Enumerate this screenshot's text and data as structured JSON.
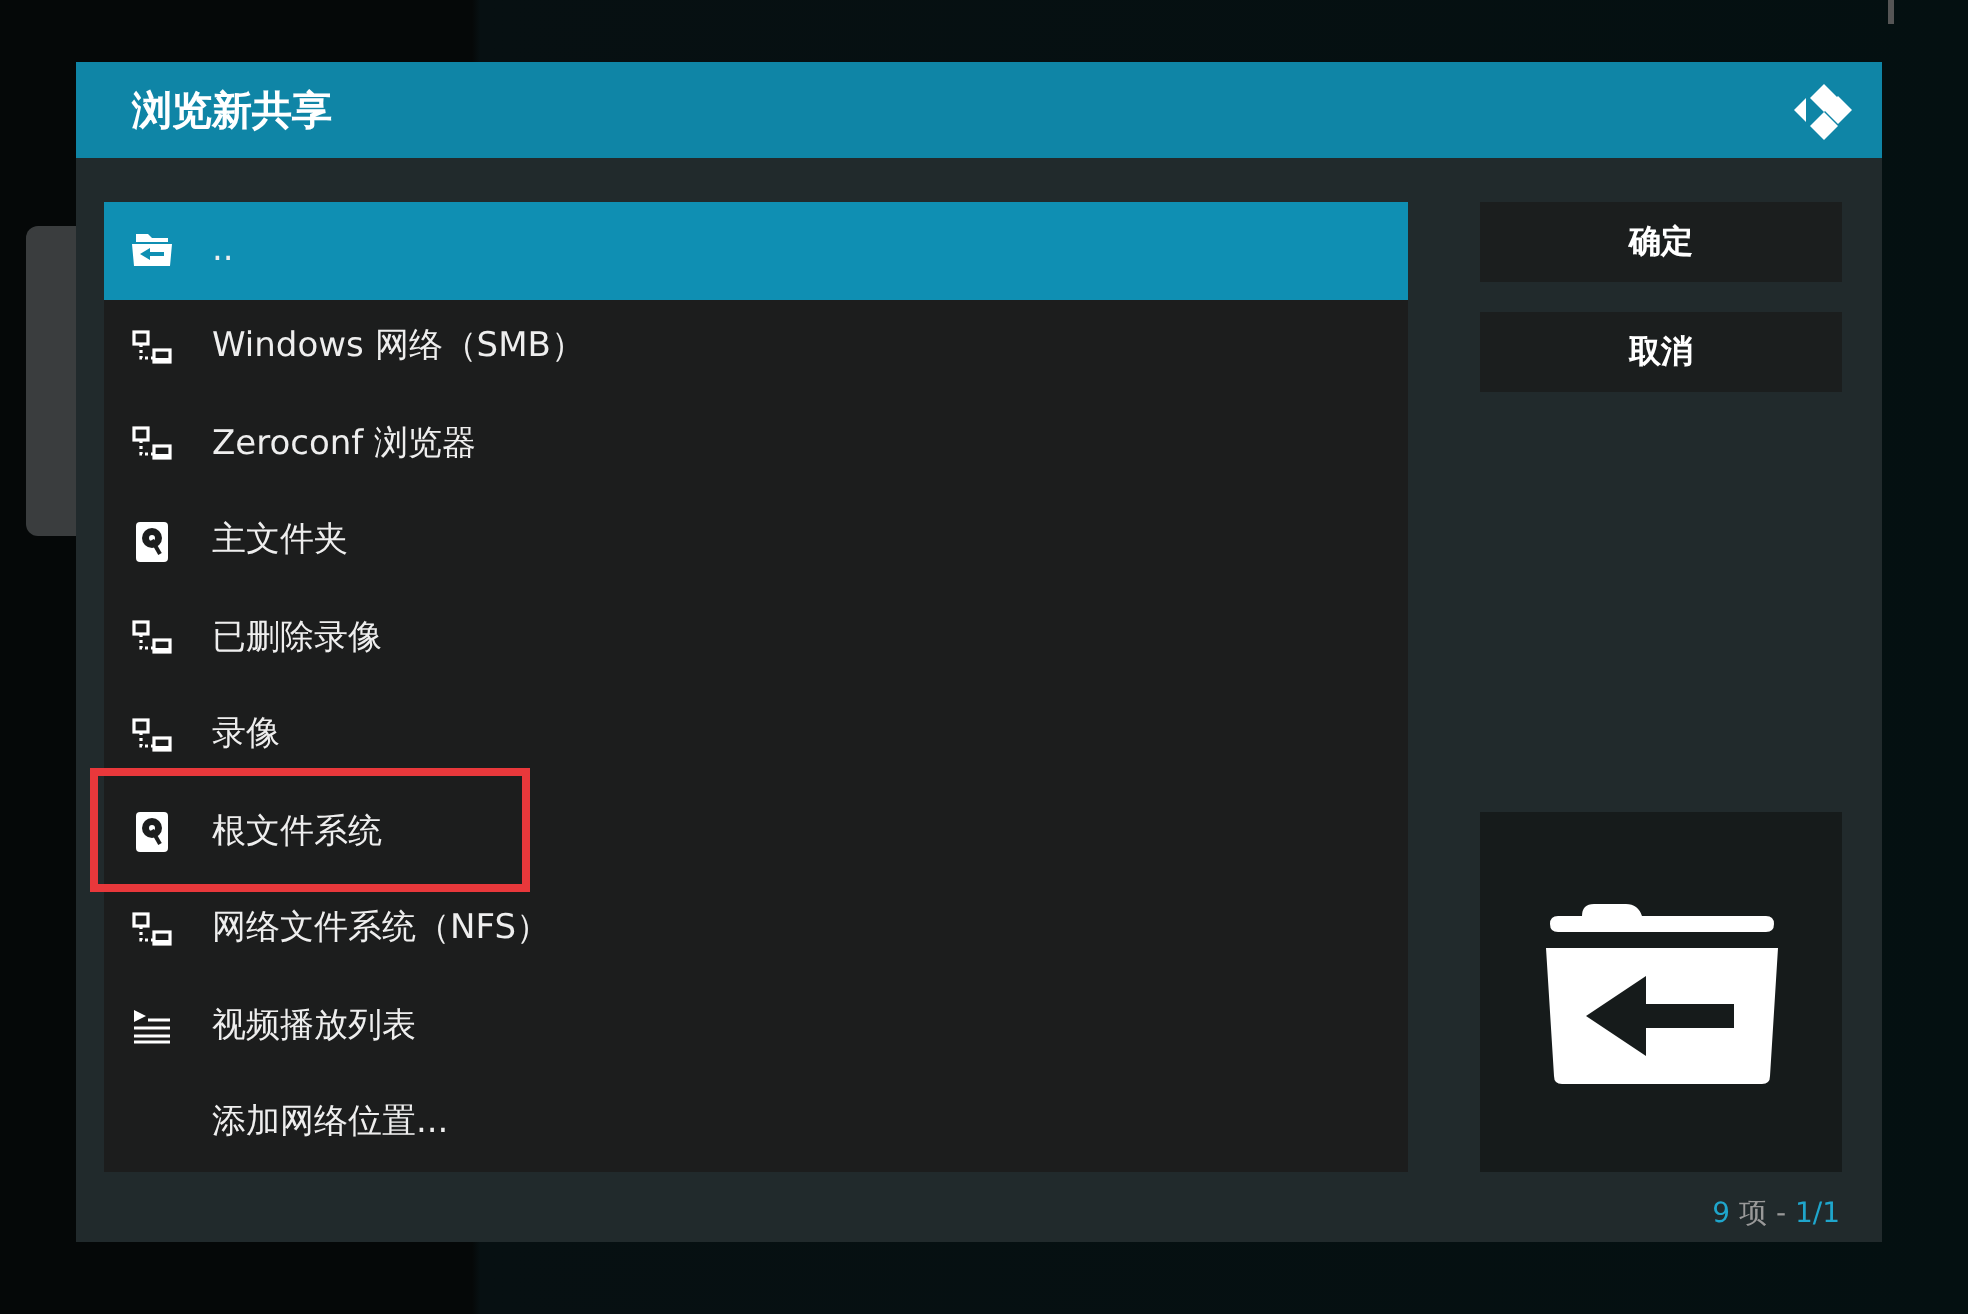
{
  "dialog": {
    "title": "浏览新共享"
  },
  "items": [
    {
      "label": "..",
      "kind": "parent",
      "selected": true,
      "highlighted": false
    },
    {
      "label": "Windows 网络（SMB）",
      "kind": "network",
      "selected": false,
      "highlighted": false
    },
    {
      "label": "Zeroconf 浏览器",
      "kind": "network",
      "selected": false,
      "highlighted": false
    },
    {
      "label": "主文件夹",
      "kind": "drive",
      "selected": false,
      "highlighted": false
    },
    {
      "label": "已删除录像",
      "kind": "network",
      "selected": false,
      "highlighted": false
    },
    {
      "label": "录像",
      "kind": "network",
      "selected": false,
      "highlighted": false
    },
    {
      "label": "根文件系统",
      "kind": "drive",
      "selected": false,
      "highlighted": true
    },
    {
      "label": "网络文件系统（NFS）",
      "kind": "network",
      "selected": false,
      "highlighted": false
    },
    {
      "label": "视频播放列表",
      "kind": "playlist",
      "selected": false,
      "highlighted": false
    },
    {
      "label": "添加网络位置...",
      "kind": "none",
      "selected": false,
      "highlighted": false
    }
  ],
  "buttons": [
    "确定",
    "取消"
  ],
  "footer": {
    "count": "9",
    "unit": "项 -",
    "page": "1/1"
  }
}
